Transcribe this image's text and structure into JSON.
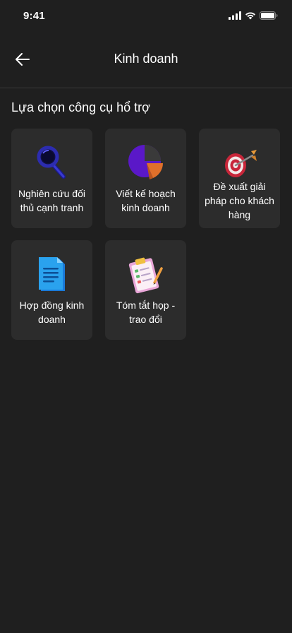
{
  "status_bar": {
    "time": "9:41",
    "icons": [
      "signal-icon",
      "wifi-icon",
      "battery-icon"
    ]
  },
  "header": {
    "title": "Kinh doanh",
    "back_icon": "arrow-left-icon"
  },
  "section": {
    "title": "Lựa chọn công cụ hổ trợ"
  },
  "tools": [
    {
      "label": "Nghiên cứu đối thủ cạnh tranh",
      "icon": "magnifier-icon"
    },
    {
      "label": "Viết kế hoạch kinh doanh",
      "icon": "pie-chart-icon"
    },
    {
      "label": "Đề xuất giải pháp cho khách hàng",
      "icon": "target-icon"
    },
    {
      "label": "Hợp đồng kinh doanh",
      "icon": "document-icon"
    },
    {
      "label": "Tóm tắt họp - trao đổi",
      "icon": "clipboard-icon"
    }
  ],
  "colors": {
    "background": "#1f1f1f",
    "card": "#2c2c2c",
    "divider": "#3a3a3a"
  }
}
